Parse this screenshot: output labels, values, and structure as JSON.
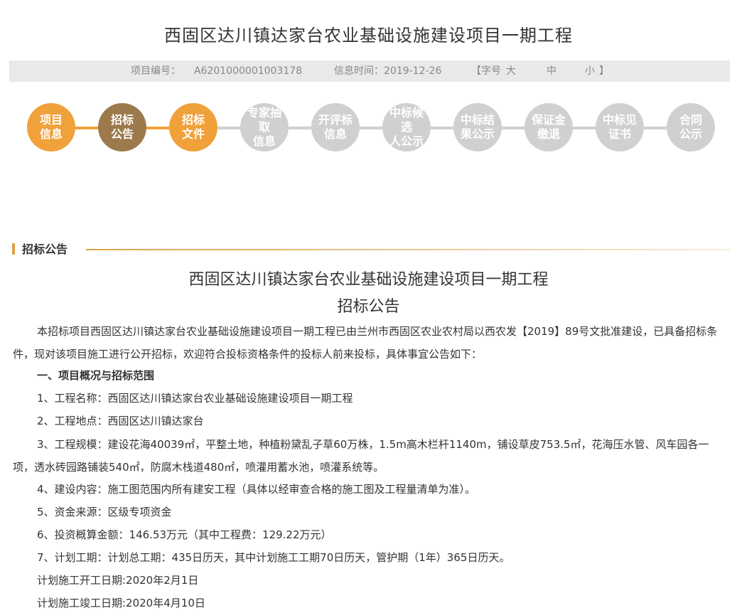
{
  "page_title": "西固区达川镇达家台农业基础设施建设项目一期工程",
  "info": {
    "project_no_label": "项目编号：",
    "project_no": "A6201000001003178",
    "info_time": "信息时间：2019-12-26",
    "font_size_open": "【字号",
    "font_large": "大",
    "font_medium": "中",
    "font_small": "小",
    "font_size_close": "】"
  },
  "steps": [
    {
      "label": "项目信息",
      "line1": "项目",
      "line2": "信息",
      "state": "active"
    },
    {
      "label": "招标公告",
      "line1": "招标",
      "line2": "公告",
      "state": "current"
    },
    {
      "label": "招标文件",
      "line1": "招标",
      "line2": "文件",
      "state": "active"
    },
    {
      "label": "专家抽取信息",
      "line1": "专家抽取",
      "line2": "信息",
      "state": "inactive"
    },
    {
      "label": "开评标信息",
      "line1": "开评标",
      "line2": "信息",
      "state": "inactive"
    },
    {
      "label": "中标候选人公示",
      "line1": "中标候选",
      "line2": "人公示",
      "state": "inactive"
    },
    {
      "label": "中标结果公示",
      "line1": "中标结",
      "line2": "果公示",
      "state": "inactive"
    },
    {
      "label": "保证金缴退",
      "line1": "保证金",
      "line2": "缴退",
      "state": "inactive"
    },
    {
      "label": "中标见证书",
      "line1": "中标见",
      "line2": "证书",
      "state": "inactive"
    },
    {
      "label": "合同公示",
      "line1": "合同",
      "line2": "公示",
      "state": "inactive"
    }
  ],
  "colors": {
    "step_active": "#f0a13a",
    "step_current": "#9c7a4c",
    "step_inactive": "#d0d0d0",
    "accent": "#e0a04a"
  },
  "section_label": "招标公告",
  "doc_title_1": "西固区达川镇达家台农业基础设施建设项目一期工程",
  "doc_title_2": "招标公告",
  "intro": "本招标项目西固区达川镇达家台农业基础设施建设项目一期工程已由兰州市西固区农业农村局以西农发【2019】89号文批准建设，已具备招标条件，现对该项目施工进行公开招标，欢迎符合投标资格条件的投标人前来投标，具体事宜公告如下：",
  "heading_1": "一、项目概况与招标范围",
  "items": {
    "i1": "1、工程名称：西固区达川镇达家台农业基础设施建设项目一期工程",
    "i2": "2、工程地点：西固区达川镇达家台",
    "i3": "3、工程规模：建设花海40039㎡，平整土地，种植粉黛乱子草60万株，1.5m高木栏杆1140m，铺设草皮753.5㎡，花海压水管、风车园各一项，透水砖园路铺装540㎡，防腐木栈道480㎡，喷灌用蓄水池，喷灌系统等。",
    "i4": "4、建设内容：施工图范围内所有建安工程（具体以经审查合格的施工图及工程量清单为准）。",
    "i5": "5、资金来源：区级专项资金",
    "i6": "6、投资概算金额：146.53万元（其中工程费：129.22万元）",
    "i7": "7、计划工期：计划总工期：435日历天，其中计划施工工期70日历天，管护期（1年）365日历天。",
    "start": "计划施工开工日期:2020年2月1日",
    "end": "计划施工竣工日期:2020年4月10日"
  }
}
